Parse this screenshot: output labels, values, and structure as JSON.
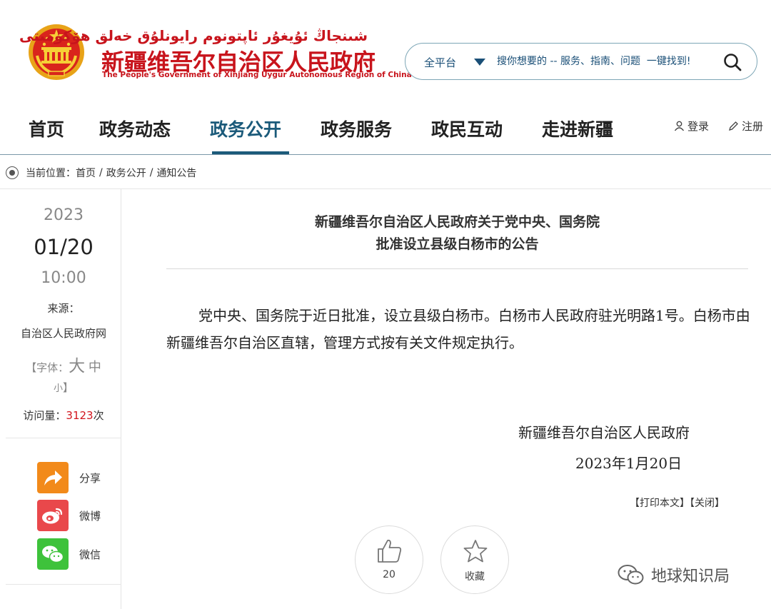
{
  "header": {
    "title_uyghur": "شىنجاڭ ئۇيغۇر ئاپتونوم رايونلۇق خەلق ھۆكۈمىتى",
    "title_cn": "新疆维吾尔自治区人民政府",
    "title_en": "The People's Government of Xinjiang Uygur Autonomous Region of China"
  },
  "search": {
    "platform": "全平台",
    "placeholder": "搜你想要的 -- 服务、指南、问题  一键找到!"
  },
  "nav": {
    "items": [
      "首页",
      "政务动态",
      "政务公开",
      "政务服务",
      "政民互动",
      "走进新疆"
    ],
    "login": "登录",
    "register": "注册"
  },
  "breadcrumb": {
    "label": "当前位置：",
    "items": [
      "首页",
      "政务公开",
      "通知公告"
    ],
    "sep": "/"
  },
  "sidebar": {
    "year": "2023",
    "date": "01/20",
    "time": "10:00",
    "source_label": "来源：",
    "source": "自治区人民政府网",
    "font_open": "【字体：",
    "font_big": "大",
    "font_mid": "中",
    "font_small": "小",
    "font_close": "】",
    "visits_label": "访问量：",
    "visits_count": "3123",
    "visits_unit": "次",
    "share": [
      {
        "label": "分享",
        "color": "#f28a1a"
      },
      {
        "label": "微博",
        "color": "#e9484b"
      },
      {
        "label": "微信",
        "color": "#3ec23b"
      }
    ]
  },
  "article": {
    "title_line1": "新疆维吾尔自治区人民政府关于党中央、国务院",
    "title_line2": "批准设立县级白杨市的公告",
    "body": "党中央、国务院于近日批准，设立县级白杨市。白杨市人民政府驻光明路1号。白杨市由新疆维吾尔自治区直辖，管理方式按有关文件规定执行。",
    "sign_org": "新疆维吾尔自治区人民政府",
    "sign_date": "2023年1月20日",
    "print": "【打印本文】",
    "close": "【关闭】",
    "like_count": "20",
    "favorite": "收藏"
  },
  "watermark": "地球知识局"
}
